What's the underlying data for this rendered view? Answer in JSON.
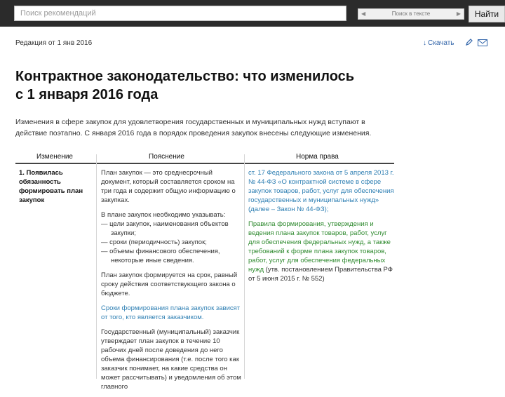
{
  "search": {
    "placeholder": "Поиск рекомендаций",
    "in_text": "Поиск в тексте",
    "find": "Найти"
  },
  "edition": {
    "label": "Редакция от 1 янв 2016"
  },
  "actions": {
    "download": "Скачать"
  },
  "doc": {
    "title_line1": "Контрактное законодательство: что изменилось",
    "title_line2": "с 1 января 2016 года",
    "intro": "Изменения в сфере закупок для удовлетворения государственных и муниципальных нужд вступают в действие поэтапно. С января 2016 года в порядок проведения закупок внесены следующие изменения."
  },
  "table": {
    "headers": [
      "Изменение",
      "Пояснение",
      "Норма права"
    ],
    "row1": {
      "change": "1. Появилась обязанность формировать план закупок",
      "expl_p1": "План закупок — это среднесрочный документ, который составляется сроком на три года и содержит общую информацию о закупках.",
      "expl_p2": "В плане закупок необходимо указывать:",
      "expl_list": [
        "— цели закупок, наименования объектов закупки;",
        "— сроки (периодичность) закупок;",
        "— объемы финансового обеспечения, некоторые иные сведения."
      ],
      "expl_p3": "План закупок формируется на срок, равный сроку действия соответствующего закона о бюджете.",
      "expl_link": "Сроки формирования плана закупок",
      "expl_link_tail": "зависят от того, кто является заказчиком.",
      "expl_p4": "Государственный (муниципальный) заказчик утверждает план закупок в течение 10 рабочих дней после доведения до него объема финансирования (т.е. после того как заказчик понимает, на какие средства он может рассчитывать) и уведомления об этом главного",
      "norm_link1": "ст. 17 Федерального закона от 5 апреля 2013 г. № 44-ФЗ «О контрактной системе в сфере закупок товаров, работ, услуг для обеспечения государственных и муниципальных нужд» (далее – Закон № 44-ФЗ);",
      "norm_link2": "Правила формирования, утверждения и ведения плана закупок товаров, работ, услуг для обеспечения федеральных нужд, а также требований к форме плана закупок товаров, работ, услуг для обеспечения федеральных нужд",
      "norm_tail": "(утв. постановлением Правительства РФ от 5 июня 2015 г. № 552)"
    }
  },
  "colors": {
    "topbar": "#2b2b2b",
    "link": "#2e7fb3",
    "green_link": "#2f8a2f"
  },
  "icons": {
    "download": "download-arrow-icon",
    "edit": "pencil-icon",
    "mail": "envelope-icon"
  }
}
